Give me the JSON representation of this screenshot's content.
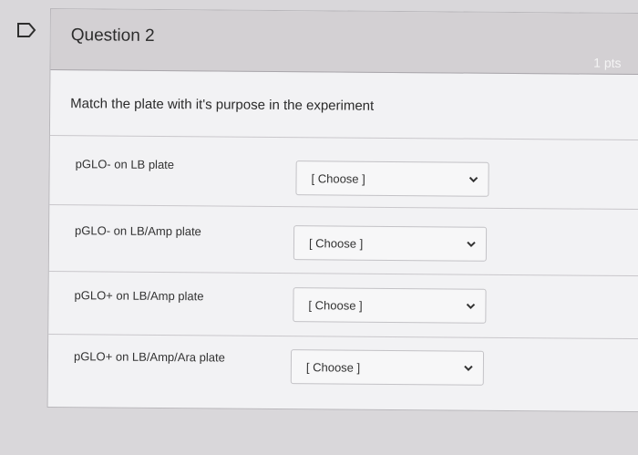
{
  "question": {
    "title": "Question 2",
    "points": "1 pts",
    "prompt": "Match the plate with it's purpose in the experiment"
  },
  "rows": [
    {
      "label": "pGLO- on LB plate",
      "selected": "[ Choose ]"
    },
    {
      "label": "pGLO- on LB/Amp plate",
      "selected": "[ Choose ]"
    },
    {
      "label": "pGLO+ on LB/Amp plate",
      "selected": "[ Choose ]"
    },
    {
      "label": "pGLO+ on LB/Amp/Ara plate",
      "selected": "[ Choose ]"
    }
  ],
  "icons": {
    "flag": "flag-icon",
    "chevron": "chevron-down-icon"
  },
  "colors": {
    "header_bg": "#d3d0d3",
    "card_bg": "#f2f2f4",
    "page_bg": "#d9d7da"
  }
}
